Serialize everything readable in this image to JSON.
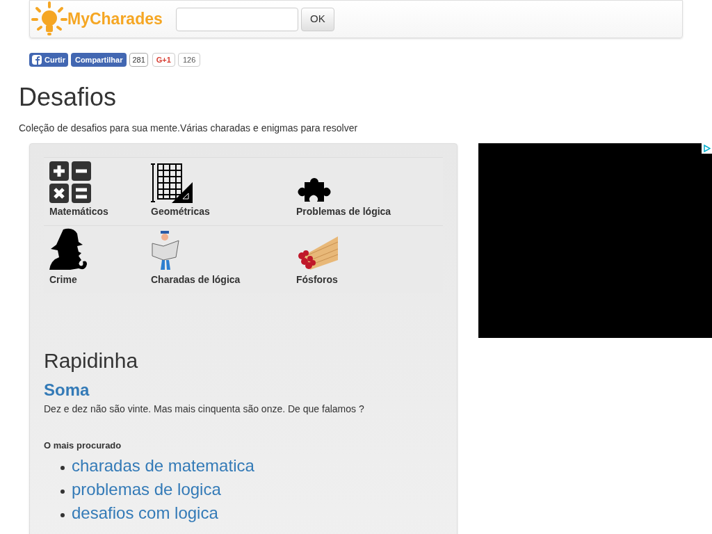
{
  "header": {
    "logo": "MyCharades",
    "search_button": "OK"
  },
  "social": {
    "like": "Curtir",
    "share": "Compartilhar",
    "share_count": "281",
    "gplus": "G+1",
    "gplus_count": "126"
  },
  "title": "Desafios",
  "subtitle": "Coleção de desafios para sua mente.Várias charadas e enigmas para resolver",
  "categories": [
    [
      {
        "label": "Matemáticos",
        "kind": "math"
      },
      {
        "label": "Geométricas",
        "kind": "geometry"
      },
      {
        "label": "Problemas de lógica",
        "kind": "puzzle"
      }
    ],
    [
      {
        "label": "Crime",
        "kind": "detective"
      },
      {
        "label": "Charadas de lógica",
        "kind": "newspaper"
      },
      {
        "label": "Fósforos",
        "kind": "matches"
      }
    ]
  ],
  "quick": {
    "heading": "Rapidinha",
    "title": "Soma",
    "text": "Dez e dez não são vinte. Mas mais cinquenta são onze. De que falamos ?"
  },
  "popular": {
    "heading": "O mais procurado",
    "links": [
      "charadas de matematica",
      "problemas de logica",
      "desafios com logica"
    ]
  }
}
